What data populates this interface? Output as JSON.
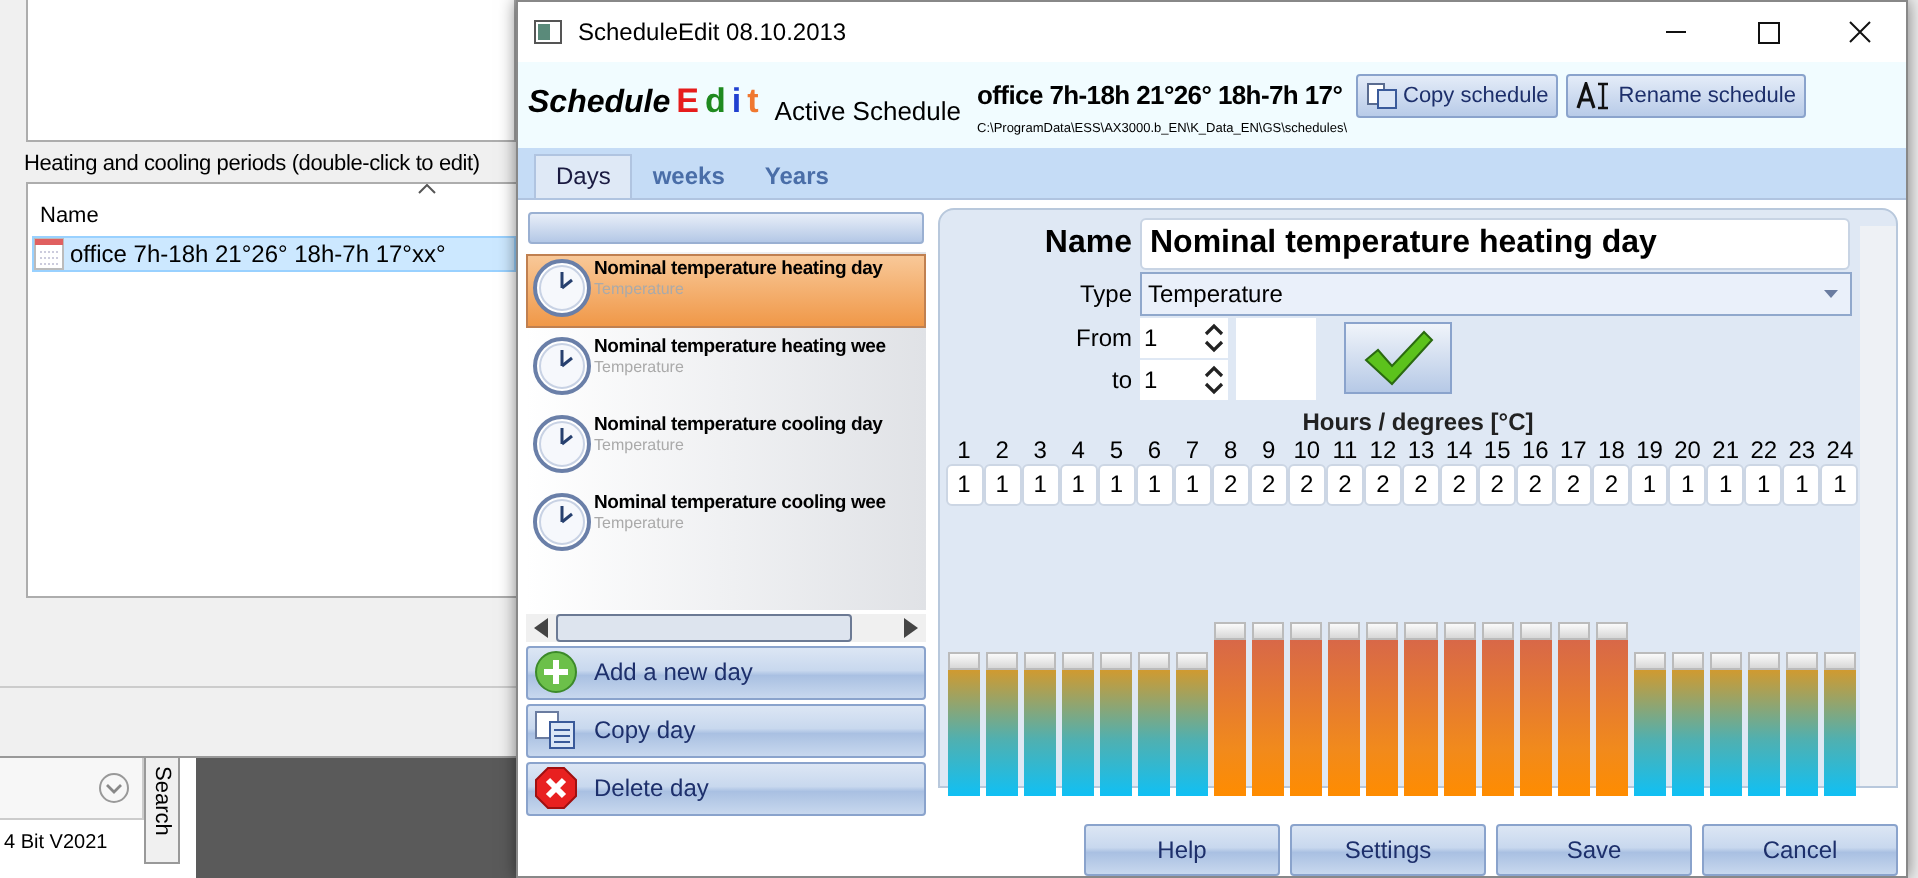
{
  "background_window": {
    "section_label": "Heating and cooling periods (double-click to edit)",
    "list": {
      "column": "Name",
      "rows": [
        {
          "name": "office 7h-18h 21°26° 18h-7h 17°xx°",
          "selected": true
        }
      ]
    }
  },
  "other_app": {
    "side_tab": "Search",
    "status_text": "4 Bit V2021"
  },
  "window": {
    "title": "ScheduleEdit 08.10.2013",
    "logo": {
      "word": "Schedule",
      "letters": [
        {
          "char": "E",
          "color": "#e61c1c"
        },
        {
          "char": "d",
          "color": "#1f8a1f"
        },
        {
          "char": "i",
          "color": "#2040d0"
        },
        {
          "char": "t",
          "color": "#f07830"
        }
      ]
    },
    "active_label": "Active Schedule",
    "active_name": "office 7h-18h 21°26° 18h-7h 17°",
    "path": "C:\\ProgramData\\ESS\\AX3000.b_EN\\K_Data_EN\\GS\\schedules\\",
    "header_buttons": [
      {
        "label": "Copy schedule",
        "kind": "copy"
      },
      {
        "label": "Rename schedule",
        "kind": "rename"
      }
    ]
  },
  "tabs": [
    {
      "label": "Days",
      "selected": true
    },
    {
      "label": "weeks",
      "selected": false
    },
    {
      "label": "Years",
      "selected": false
    }
  ],
  "days": [
    {
      "name": "Nominal temperature heating day",
      "type": "Temperature",
      "selected": true
    },
    {
      "name": "Nominal temperature heating wee",
      "type": "Temperature",
      "selected": false
    },
    {
      "name": "Nominal temperature cooling day",
      "type": "Temperature",
      "selected": false
    },
    {
      "name": "Nominal temperature cooling wee",
      "type": "Temperature",
      "selected": false
    }
  ],
  "day_actions": [
    {
      "label": "Add a new day",
      "kind": "add"
    },
    {
      "label": "Copy day",
      "kind": "copy"
    },
    {
      "label": "Delete day",
      "kind": "delete"
    }
  ],
  "editor": {
    "name_label": "Name",
    "name_value": "Nominal temperature heating day",
    "type_label": "Type",
    "type_value": "Temperature",
    "from_label": "From",
    "from_value": "1",
    "to_label": "to",
    "to_value": "1",
    "hours_title": "Hours / degrees [°C]",
    "hours": [
      {
        "hour": "1",
        "value": "1",
        "level": 0.44,
        "kind": "low"
      },
      {
        "hour": "2",
        "value": "1",
        "level": 0.44,
        "kind": "low"
      },
      {
        "hour": "3",
        "value": "1",
        "level": 0.44,
        "kind": "low"
      },
      {
        "hour": "4",
        "value": "1",
        "level": 0.44,
        "kind": "low"
      },
      {
        "hour": "5",
        "value": "1",
        "level": 0.44,
        "kind": "low"
      },
      {
        "hour": "6",
        "value": "1",
        "level": 0.44,
        "kind": "low"
      },
      {
        "hour": "7",
        "value": "1",
        "level": 0.44,
        "kind": "low"
      },
      {
        "hour": "8",
        "value": "2",
        "level": 0.54,
        "kind": "high"
      },
      {
        "hour": "9",
        "value": "2",
        "level": 0.54,
        "kind": "high"
      },
      {
        "hour": "10",
        "value": "2",
        "level": 0.54,
        "kind": "high"
      },
      {
        "hour": "11",
        "value": "2",
        "level": 0.54,
        "kind": "high"
      },
      {
        "hour": "12",
        "value": "2",
        "level": 0.54,
        "kind": "high"
      },
      {
        "hour": "13",
        "value": "2",
        "level": 0.54,
        "kind": "high"
      },
      {
        "hour": "14",
        "value": "2",
        "level": 0.54,
        "kind": "high"
      },
      {
        "hour": "15",
        "value": "2",
        "level": 0.54,
        "kind": "high"
      },
      {
        "hour": "16",
        "value": "2",
        "level": 0.54,
        "kind": "high"
      },
      {
        "hour": "17",
        "value": "2",
        "level": 0.54,
        "kind": "high"
      },
      {
        "hour": "18",
        "value": "2",
        "level": 0.54,
        "kind": "high"
      },
      {
        "hour": "19",
        "value": "1",
        "level": 0.44,
        "kind": "low"
      },
      {
        "hour": "20",
        "value": "1",
        "level": 0.44,
        "kind": "low"
      },
      {
        "hour": "21",
        "value": "1",
        "level": 0.44,
        "kind": "low"
      },
      {
        "hour": "22",
        "value": "1",
        "level": 0.44,
        "kind": "low"
      },
      {
        "hour": "23",
        "value": "1",
        "level": 0.44,
        "kind": "low"
      },
      {
        "hour": "24",
        "value": "1",
        "level": 0.44,
        "kind": "low"
      }
    ]
  },
  "footer_buttons": [
    "Help",
    "Settings",
    "Save",
    "Cancel"
  ]
}
